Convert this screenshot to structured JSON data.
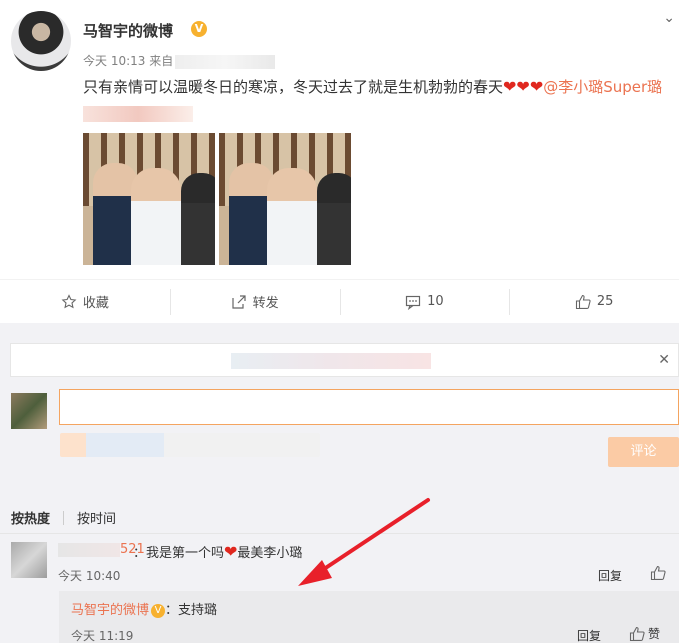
{
  "post": {
    "author": "马智宇的微博",
    "verified_badge": "V",
    "time": "今天 10:13",
    "source_prefix": "来自",
    "text_main": "只有亲情可以温暖冬日的寒凉，冬天过去了就是生机勃勃的春天",
    "hearts": "❤❤❤",
    "mention": "@李小璐Super璐",
    "photo_count": 2
  },
  "actions": {
    "favorite": "收藏",
    "repost": "转发",
    "comment_count": "10",
    "like_count": "25"
  },
  "comment_box": {
    "submit": "评论"
  },
  "sort": {
    "hot": "按热度",
    "time": "按时间"
  },
  "comments": [
    {
      "name_suffix": "521",
      "text_before": "：我是第一个吗",
      "heart": "❤",
      "text_after": "最美李小璐",
      "time": "今天 10:40",
      "reply": "回复"
    }
  ],
  "sub_reply": {
    "author": "马智宇的微博",
    "badge": "V",
    "text": "：支持璐",
    "time": "今天 11:19",
    "reply": "回复",
    "like": "赞"
  },
  "colors": {
    "mention": "#eb7350",
    "heart": "#e0281f",
    "badge": "#f7b12f",
    "arrow": "#e8202a"
  }
}
